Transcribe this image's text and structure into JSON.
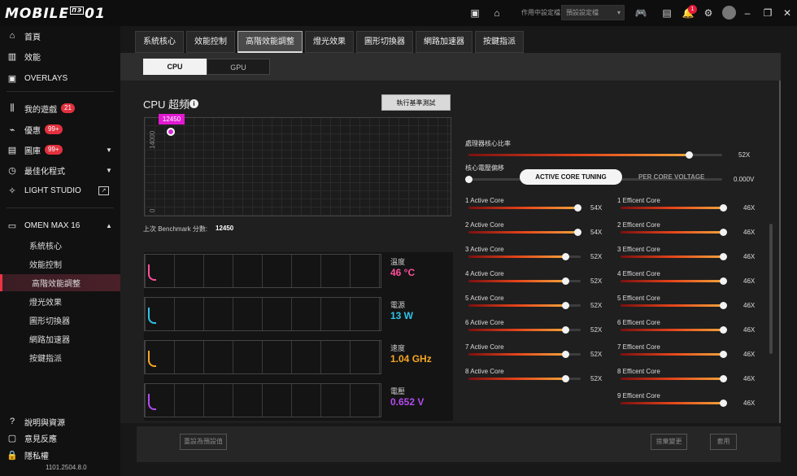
{
  "brand": {
    "logo_text": "MOBILE01",
    "logo_sup": "ПЭ"
  },
  "topbar": {
    "profile_label": "作用中設定檔",
    "profile_value": "預設設定檔",
    "notification_count": "1"
  },
  "sidebar": {
    "items": [
      {
        "label": "首頁",
        "icon": "home-icon"
      },
      {
        "label": "效能",
        "icon": "performance-icon"
      },
      {
        "label": "OVERLAYS",
        "icon": "overlays-icon"
      },
      {
        "label": "我的遊戲",
        "icon": "library-icon",
        "badge": "21"
      },
      {
        "label": "優惠",
        "icon": "deals-icon",
        "badge": "99+"
      },
      {
        "label": "圖庫",
        "icon": "gallery-icon",
        "badge": "99+"
      },
      {
        "label": "最佳化程式",
        "icon": "optimizer-icon"
      },
      {
        "label": "LIGHT STUDIO",
        "icon": "light-studio-icon"
      }
    ],
    "device": {
      "label": "OMEN MAX 16",
      "icon": "laptop-icon"
    },
    "sub_items": [
      "系統核心",
      "效能控制",
      "高階效能調整",
      "燈光效果",
      "圖形切換器",
      "網路加速器",
      "按鍵指派"
    ],
    "bottom": [
      {
        "label": "說明與資源",
        "icon": "help-icon"
      },
      {
        "label": "意見反應",
        "icon": "feedback-icon"
      },
      {
        "label": "隱私權",
        "icon": "privacy-icon"
      }
    ],
    "version": "1101.2504.8.0"
  },
  "tabs": [
    "系統核心",
    "效能控制",
    "高階效能調整",
    "燈光效果",
    "圖形切換器",
    "網路加速器",
    "按鍵指派"
  ],
  "segment": {
    "cpu": "CPU",
    "gpu": "GPU"
  },
  "overclock": {
    "title": "CPU 超頻",
    "benchmark_button": "執行基準測試",
    "last_label": "上次 Benchmark 分數:",
    "last_value": "12450"
  },
  "chart_data": {
    "type": "line",
    "y_ticks": [
      "14000",
      "0"
    ],
    "ylim": [
      0,
      14000
    ],
    "points": [
      {
        "label": "12450",
        "value": 12450
      }
    ]
  },
  "monitor": [
    {
      "label": "溫度",
      "value": "46 °C",
      "color": "#ff4f9c"
    },
    {
      "label": "電源",
      "value": "13 W",
      "color": "#2ec3e8"
    },
    {
      "label": "速度",
      "value": "1.04 GHz",
      "color": "#f5a623"
    },
    {
      "label": "電壓",
      "value": "0.652 V",
      "color": "#b34bf0"
    }
  ],
  "global": [
    {
      "label": "處理器核心比率",
      "value": "52X",
      "level": 0.87
    },
    {
      "label": "核心電壓偏移",
      "value": "0.000V",
      "level": 0.0
    }
  ],
  "tuning": {
    "active": "ACTIVE CORE TUNING",
    "inactive": "PER CORE VOLTAGE"
  },
  "active_cores": [
    {
      "label": "1 Active Core",
      "value": "54X",
      "level": 0.97
    },
    {
      "label": "2 Active Core",
      "value": "54X",
      "level": 0.97
    },
    {
      "label": "3 Active Core",
      "value": "52X",
      "level": 0.86
    },
    {
      "label": "4 Active Core",
      "value": "52X",
      "level": 0.86
    },
    {
      "label": "5 Active Core",
      "value": "52X",
      "level": 0.86
    },
    {
      "label": "6 Active Core",
      "value": "52X",
      "level": 0.86
    },
    {
      "label": "7 Active Core",
      "value": "52X",
      "level": 0.86
    },
    {
      "label": "8 Active Core",
      "value": "52X",
      "level": 0.86
    }
  ],
  "efficient_cores": [
    {
      "label": "1 Efficent Core",
      "value": "46X",
      "level": 0.97
    },
    {
      "label": "2 Efficent Core",
      "value": "46X",
      "level": 0.97
    },
    {
      "label": "3 Efficent Core",
      "value": "46X",
      "level": 0.97
    },
    {
      "label": "4 Efficent Core",
      "value": "46X",
      "level": 0.97
    },
    {
      "label": "5 Efficent Core",
      "value": "46X",
      "level": 0.97
    },
    {
      "label": "6 Efficent Core",
      "value": "46X",
      "level": 0.97
    },
    {
      "label": "7 Efficent Core",
      "value": "46X",
      "level": 0.97
    },
    {
      "label": "8 Efficent Core",
      "value": "46X",
      "level": 0.97
    },
    {
      "label": "9 Efficent Core",
      "value": "46X",
      "level": 0.97
    }
  ],
  "footer": {
    "reset": "重設為預設值",
    "discard": "捨棄變更",
    "apply": "套用"
  }
}
